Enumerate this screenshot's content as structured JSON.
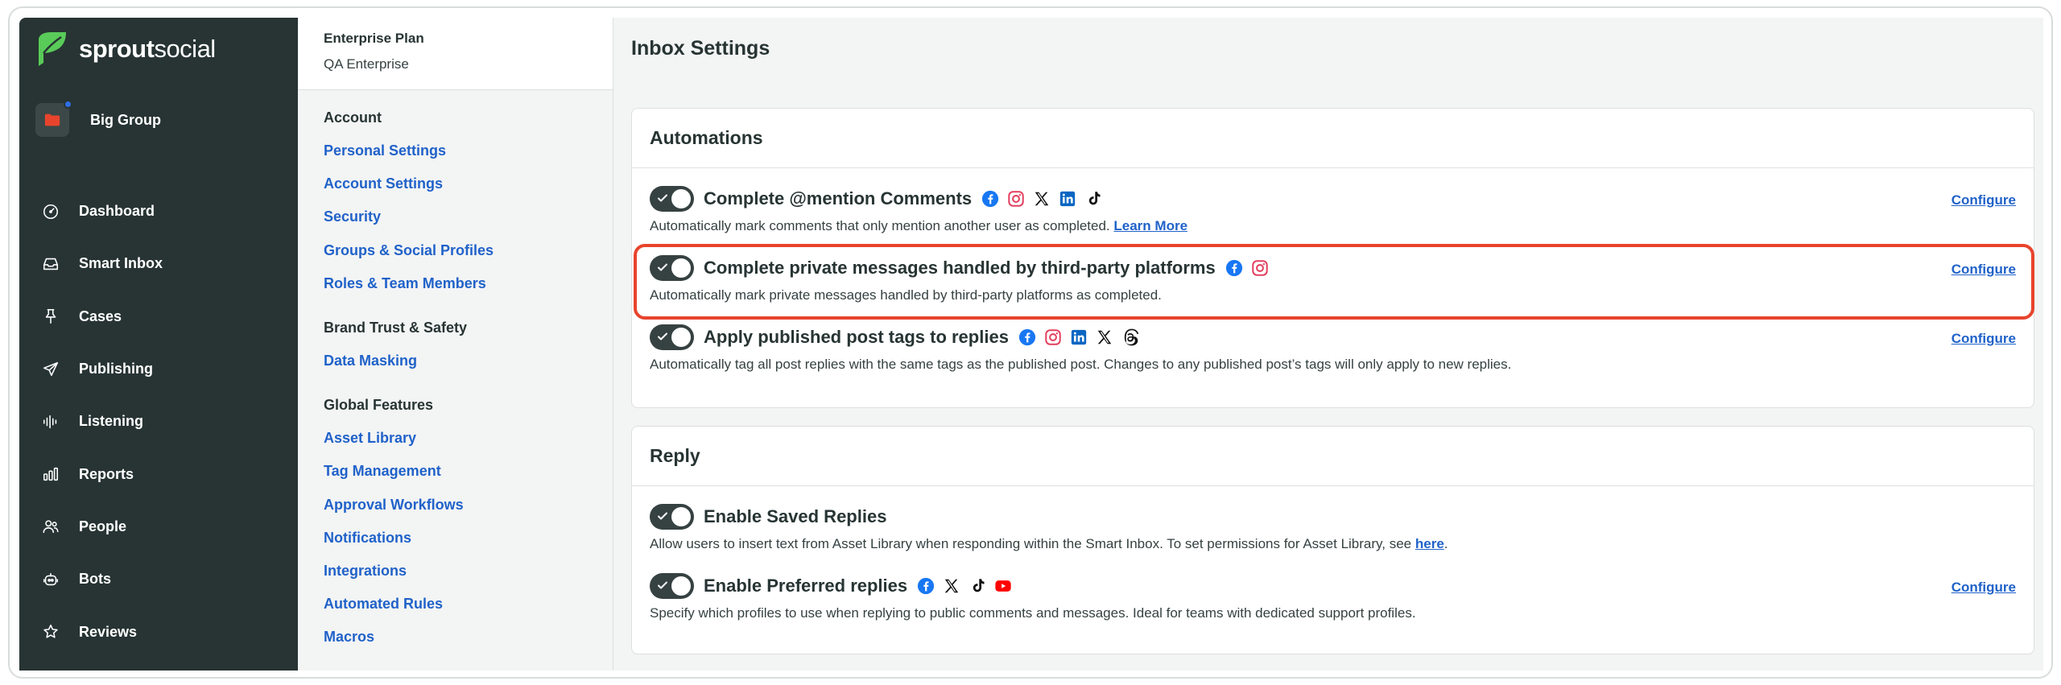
{
  "brand": {
    "name_bold": "sprout",
    "name_light": "social",
    "green": "#59cb59",
    "sidebar_bg": "#273433",
    "link_color": "#2062c9",
    "highlight_color": "#e8442d"
  },
  "group": {
    "name": "Big Group",
    "icon": "folder-icon"
  },
  "sidebar": {
    "items": [
      {
        "label": "Dashboard",
        "icon": "dashboard-gauge-icon"
      },
      {
        "label": "Smart Inbox",
        "icon": "inbox-tray-icon"
      },
      {
        "label": "Cases",
        "icon": "pin-icon"
      },
      {
        "label": "Publishing",
        "icon": "paper-plane-icon"
      },
      {
        "label": "Listening",
        "icon": "sound-wave-icon"
      },
      {
        "label": "Reports",
        "icon": "bar-chart-icon"
      },
      {
        "label": "People",
        "icon": "people-icon"
      },
      {
        "label": "Bots",
        "icon": "bot-icon"
      },
      {
        "label": "Reviews",
        "icon": "star-icon"
      }
    ]
  },
  "plan": {
    "title": "Enterprise Plan",
    "subtitle": "QA Enterprise"
  },
  "settings_nav": {
    "account": {
      "label": "Account",
      "links": [
        "Personal Settings",
        "Account Settings",
        "Security",
        "Groups & Social Profiles",
        "Roles & Team Members"
      ]
    },
    "brand_trust": {
      "label": "Brand Trust & Safety",
      "links": [
        "Data Masking"
      ]
    },
    "global_features": {
      "label": "Global Features",
      "links": [
        "Asset Library",
        "Tag Management",
        "Approval Workflows",
        "Notifications",
        "Integrations",
        "Automated Rules",
        "Macros"
      ]
    }
  },
  "page": {
    "title": "Inbox Settings"
  },
  "automations": {
    "title": "Automations",
    "rows": [
      {
        "title": "Complete @mention Comments",
        "networks": [
          "facebook-icon",
          "instagram-icon",
          "x-icon",
          "linkedin-icon",
          "tiktok-icon"
        ],
        "desc": "Automatically mark comments that only mention another user as completed.",
        "link": "Learn More",
        "configure": "Configure",
        "enabled": true
      },
      {
        "title": "Complete private messages handled by third-party platforms",
        "networks": [
          "facebook-icon",
          "instagram-icon"
        ],
        "desc": "Automatically mark private messages handled by third-party platforms as completed.",
        "configure": "Configure",
        "enabled": true
      },
      {
        "title": "Apply published post tags to replies",
        "networks": [
          "facebook-icon",
          "instagram-icon",
          "linkedin-icon",
          "x-icon",
          "threads-icon"
        ],
        "desc": "Automatically tag all post replies with the same tags as the published post. Changes to any published post’s tags will only apply to new replies.",
        "configure": "Configure",
        "enabled": true
      }
    ]
  },
  "reply": {
    "title": "Reply",
    "rows": [
      {
        "title": "Enable Saved Replies",
        "desc": "Allow users to insert text from Asset Library when responding within the Smart Inbox. To set permissions for Asset Library, see",
        "link": "here",
        "link_suffix": ".",
        "enabled": true
      },
      {
        "title": "Enable Preferred replies",
        "networks": [
          "facebook-icon",
          "x-icon",
          "tiktok-icon",
          "youtube-icon"
        ],
        "desc": "Specify which profiles to use when replying to public comments and messages. Ideal for teams with dedicated support profiles.",
        "configure": "Configure",
        "enabled": true
      }
    ]
  }
}
